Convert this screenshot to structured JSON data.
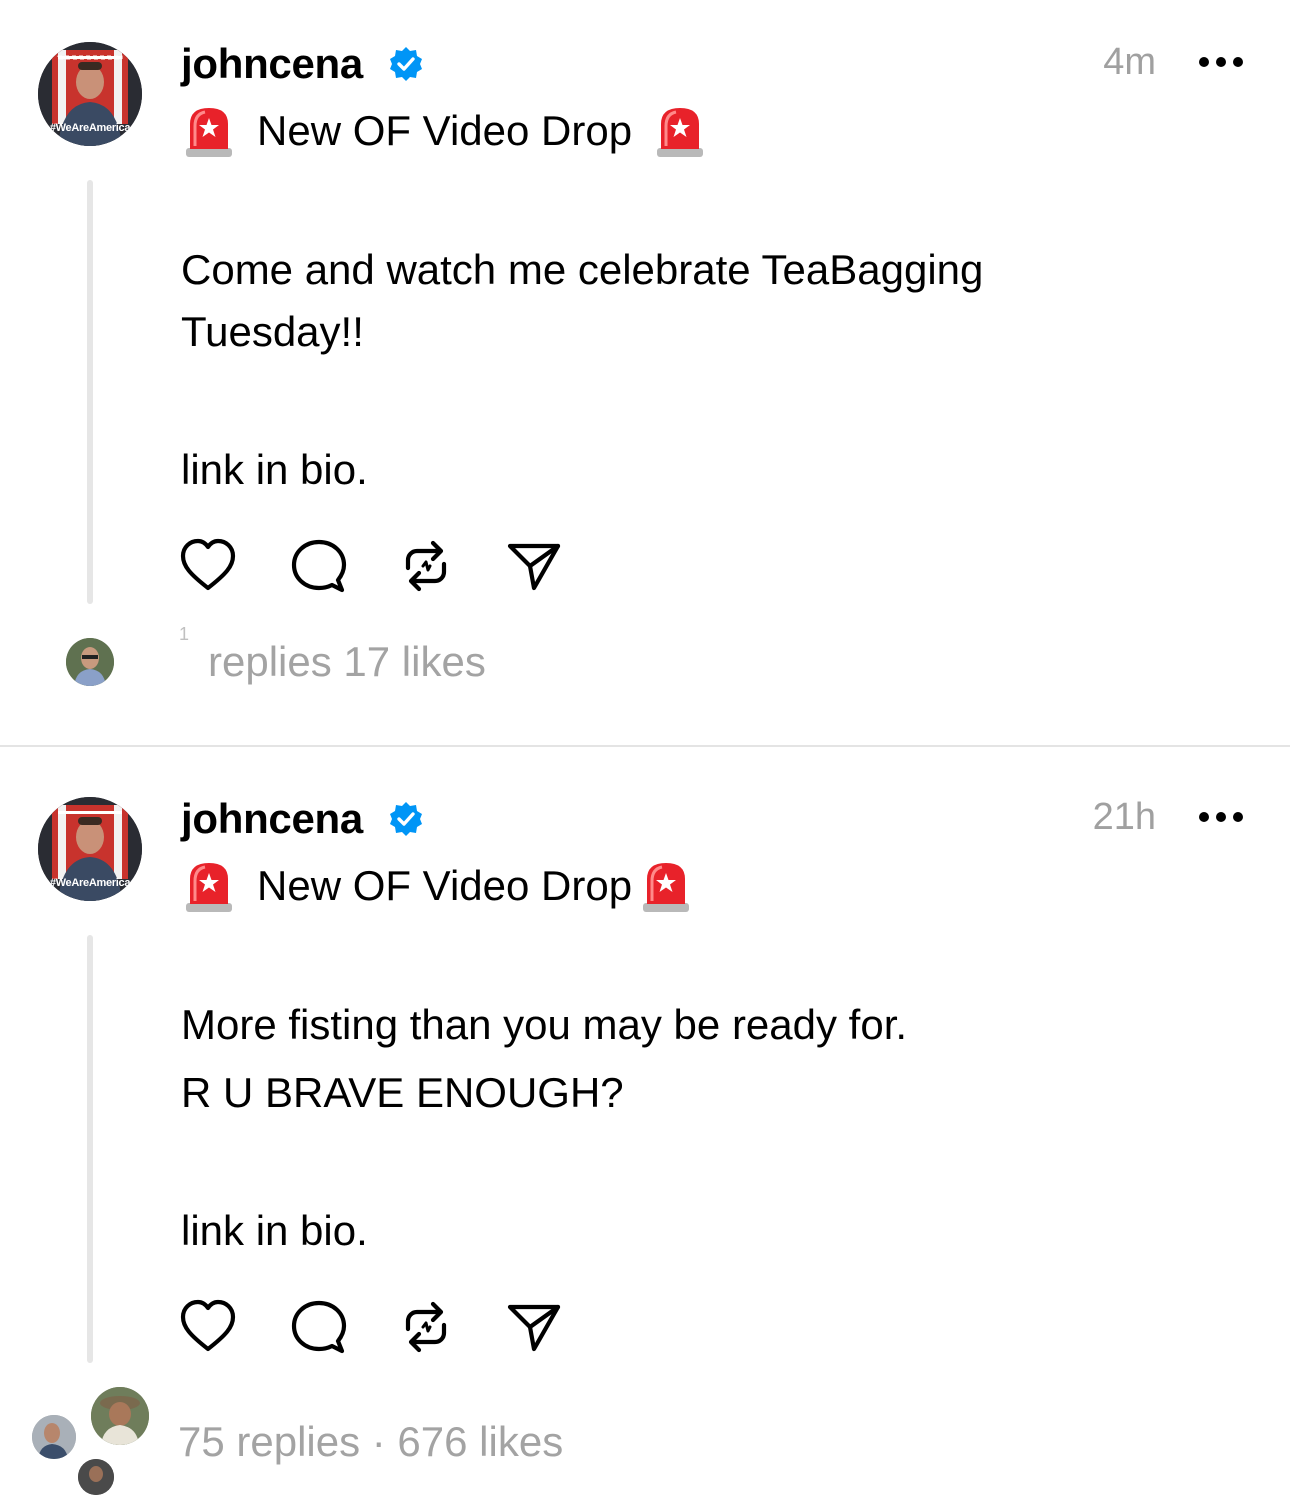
{
  "posts": [
    {
      "username": "johncena",
      "timestamp": "4m",
      "avatar_caption": "#WeAreAmerica",
      "headline": "New OF Video Drop",
      "body_lines": [
        "Come and watch me celebrate TeaBagging",
        "Tuesday!!",
        "",
        "link in bio."
      ],
      "replies_count": "1",
      "replies_label": "replies",
      "likes_label": "17 likes"
    },
    {
      "username": "johncena",
      "timestamp": "21h",
      "avatar_caption": "#WeAreAmerica",
      "headline": "New OF Video Drop",
      "body_lines": [
        "More fisting than you may be ready for.",
        "R U BRAVE ENOUGH?",
        "",
        "link in bio."
      ],
      "stats_label": "75 replies · 676 likes"
    }
  ],
  "icons": {
    "verified": "verified-badge-icon",
    "siren": "rotating-light-emoji",
    "like": "heart-icon",
    "reply": "comment-bubble-icon",
    "repost": "repost-arrows-icon",
    "share": "send-paper-plane-icon",
    "more": "ellipsis-icon"
  },
  "colors": {
    "verified_blue": "#0095f6",
    "siren_red": "#e8222a",
    "muted_text": "#a0a0a0",
    "divider": "#e4e4e4"
  }
}
